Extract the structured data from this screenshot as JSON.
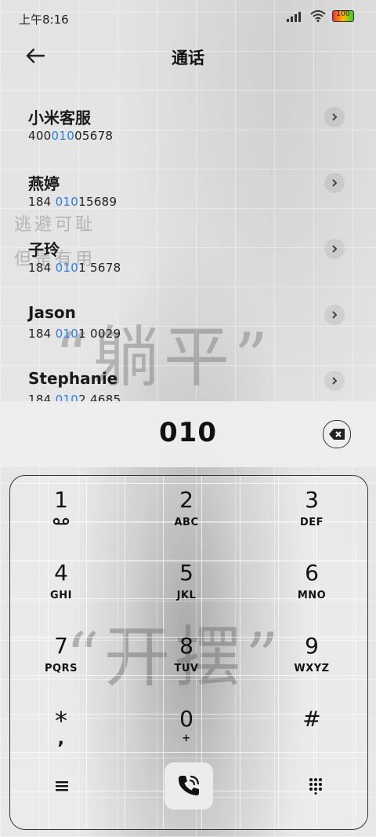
{
  "status": {
    "time": "上午8:16",
    "battery": "100"
  },
  "header": {
    "title": "通话"
  },
  "results": [
    {
      "name": "小米客服",
      "num_pre": "400",
      "num_hl": "010",
      "num_post": "05678"
    },
    {
      "name": "燕婷",
      "num_pre": "184 ",
      "num_hl": "010",
      "num_post": "15689"
    },
    {
      "name": "子玲",
      "num_pre": "184 ",
      "num_hl": "010",
      "num_post": "1 5678"
    },
    {
      "name": "Jason",
      "num_pre": "184 ",
      "num_hl": "010",
      "num_post": "1 0029"
    },
    {
      "name": "Stephanie",
      "num_pre": "184 ",
      "num_hl": "010",
      "num_post": "2 4685"
    }
  ],
  "dialer": {
    "input": "010",
    "keys": [
      {
        "digit": "1",
        "letters": "ꝏ"
      },
      {
        "digit": "2",
        "letters": "ABC"
      },
      {
        "digit": "3",
        "letters": "DEF"
      },
      {
        "digit": "4",
        "letters": "GHI"
      },
      {
        "digit": "5",
        "letters": "JKL"
      },
      {
        "digit": "6",
        "letters": "MNO"
      },
      {
        "digit": "7",
        "letters": "PQRS"
      },
      {
        "digit": "8",
        "letters": "TUV"
      },
      {
        "digit": "9",
        "letters": "WXYZ"
      },
      {
        "digit": "*",
        "letters": ","
      },
      {
        "digit": "0",
        "letters": "+"
      },
      {
        "digit": "#",
        "letters": ""
      }
    ]
  },
  "wallpaper": {
    "text1": "逃避可耻",
    "text2": "但是有用",
    "text3": "“躺平”",
    "text4": "“开摆”"
  }
}
